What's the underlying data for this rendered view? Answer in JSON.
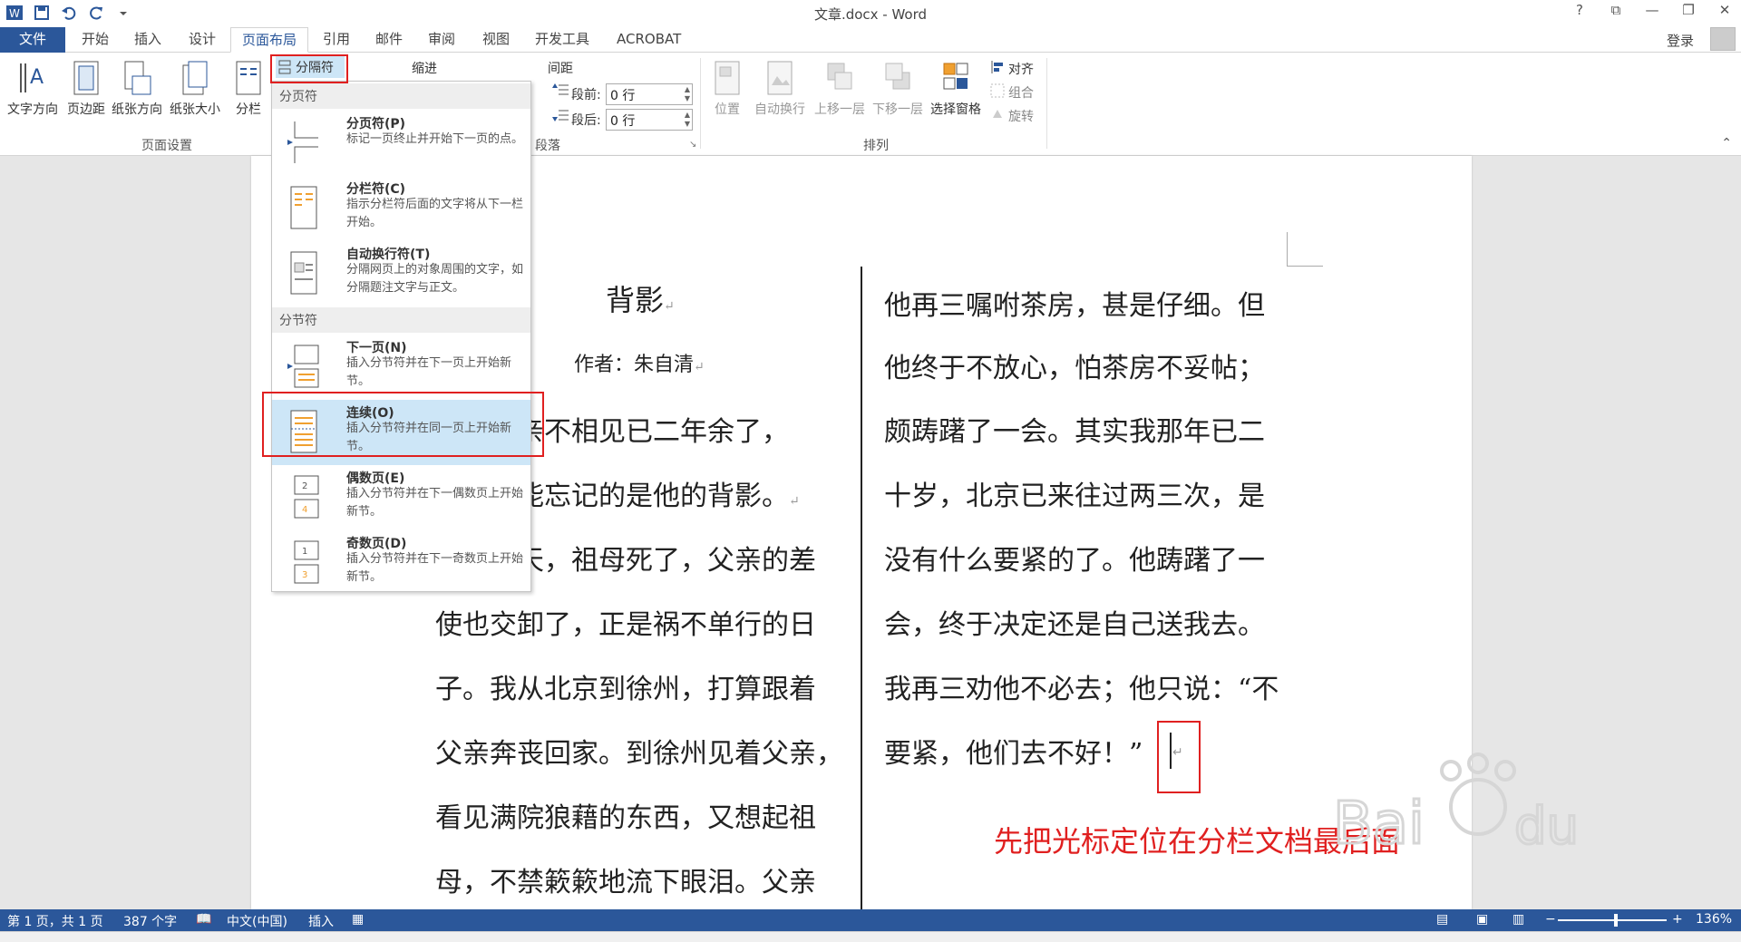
{
  "window": {
    "title": "文章.docx - Word",
    "controls": [
      "?",
      "⧉",
      "—",
      "❐",
      "✕"
    ]
  },
  "tabs": [
    "文件",
    "开始",
    "插入",
    "设计",
    "页面布局",
    "引用",
    "邮件",
    "审阅",
    "视图",
    "开发工具",
    "ACROBAT"
  ],
  "active_tab": "页面布局",
  "login": "登录",
  "ribbon": {
    "page_setup": {
      "buttons": [
        "文字方向",
        "页边距",
        "纸张方向",
        "纸张大小",
        "分栏"
      ],
      "breaks": "分隔符",
      "label": "页面设置"
    },
    "paragraph": {
      "indent_label": "缩进",
      "spacing_label": "间距",
      "before_label": "段前:",
      "before_value": "0 行",
      "after_label": "段后:",
      "after_value": "0 行",
      "label": "段落"
    },
    "arrange": {
      "buttons": [
        "位置",
        "自动换行",
        "上移一层",
        "下移一层",
        "选择窗格"
      ],
      "align": "对齐",
      "group": "组合",
      "rotate": "旋转",
      "label": "排列"
    }
  },
  "dropdown": {
    "page_breaks_header": "分页符",
    "section_breaks_header": "分节符",
    "items": [
      {
        "title": "分页符(P)",
        "desc": "标记一页终止并开始下一页的点。"
      },
      {
        "title": "分栏符(C)",
        "desc": "指示分栏符后面的文字将从下一栏开始。"
      },
      {
        "title": "自动换行符(T)",
        "desc": "分隔网页上的对象周围的文字，如分隔题注文字与正文。"
      },
      {
        "title": "下一页(N)",
        "desc": "插入分节符并在下一页上开始新节。"
      },
      {
        "title": "连续(O)",
        "desc": "插入分节符并在同一页上开始新节。"
      },
      {
        "title": "偶数页(E)",
        "desc": "插入分节符并在下一偶数页上开始新节。"
      },
      {
        "title": "奇数页(D)",
        "desc": "插入分节符并在下一奇数页上开始新节。"
      }
    ]
  },
  "document": {
    "title": "背影",
    "author": "作者：朱自清",
    "left_column": [
      "我与父亲不相见已二年余了，",
      "我最不能忘记的是他的背影。",
      "那年冬天，祖母死了，父亲的差",
      "使也交卸了，正是祸不单行的日",
      "子。我从北京到徐州，打算跟着",
      "父亲奔丧回家。到徐州见着父亲，",
      "看见满院狼藉的东西，又想起祖",
      "母，不禁簌簌地流下眼泪。父亲"
    ],
    "right_column": [
      "他再三嘱咐茶房，甚是仔细。但",
      "他终于不放心，怕茶房不妥帖；",
      "颇踌躇了一会。其实我那年已二",
      "十岁，北京已来往过两三次，是",
      "没有什么要紧的了。他踌躇了一",
      "会，终于决定还是自己送我去。",
      "我再三劝他不必去；他只说：“不",
      "要紧，他们去不好！”"
    ]
  },
  "annotation": "先把光标定位在分栏文档最后面",
  "status": {
    "page": "第 1 页，共 1 页",
    "words": "387 个字",
    "lang": "中文(中国)",
    "mode": "插入",
    "zoom": "136%"
  },
  "colors": {
    "accent": "#2b579a",
    "annotation": "#e02020",
    "highlight": "#cde6f7"
  }
}
